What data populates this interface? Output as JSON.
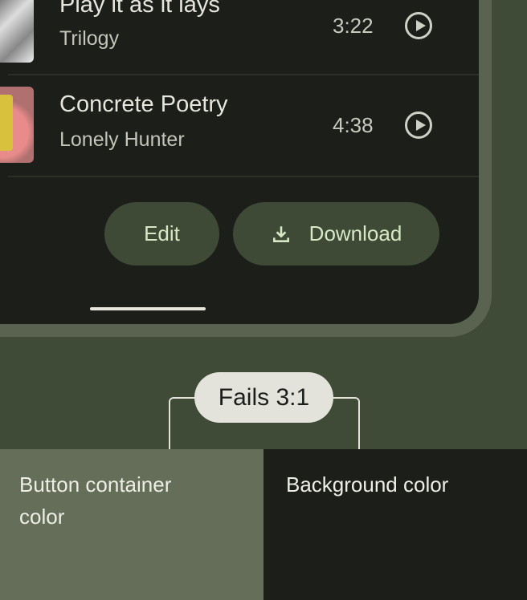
{
  "tracks": [
    {
      "title": "Play it as it lays",
      "artist": "Trilogy",
      "duration": "3:22"
    },
    {
      "title": "Concrete Poetry",
      "artist": "Lonely Hunter",
      "duration": "4:38"
    }
  ],
  "actions": {
    "edit": "Edit",
    "download": "Download"
  },
  "annotation": {
    "label": "Fails 3:1"
  },
  "swatches": {
    "left": "Button container color",
    "right": "Background color",
    "left_color": "#646e58",
    "right_color": "#1c1e19"
  }
}
